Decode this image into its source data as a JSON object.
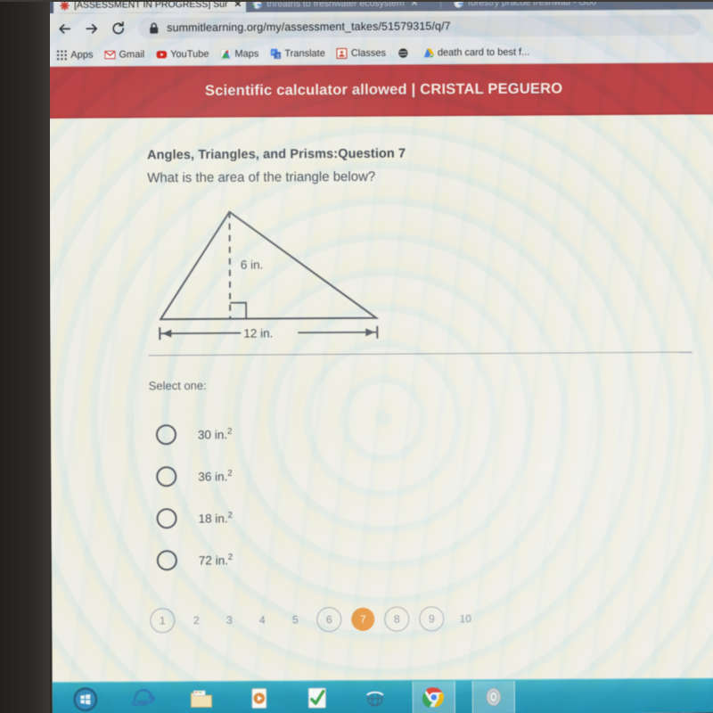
{
  "browser": {
    "tabs": [
      {
        "title": "[ASSESSMENT IN PROGRESS] Sur",
        "favicon": "summit-asterisk-icon",
        "active": true,
        "close": "✕"
      },
      {
        "title": "threaths to freshwater ecosystem",
        "favicon": "google-icon",
        "active": false,
        "close": "✕"
      },
      {
        "title": "forestry pracue freshwati - Goo",
        "favicon": "google-icon",
        "active": false,
        "close": ""
      }
    ],
    "nav": {
      "back": "←",
      "forward": "→",
      "reload": "⟳"
    },
    "omnibox": {
      "lock": "lock-icon",
      "url": "summitlearning.org/my/assessment_takes/51579315/q/7"
    },
    "bookmarks": [
      {
        "label": "Apps",
        "icon": "apps-grid-icon"
      },
      {
        "label": "Gmail",
        "icon": "gmail-icon"
      },
      {
        "label": "YouTube",
        "icon": "youtube-icon"
      },
      {
        "label": "Maps",
        "icon": "maps-icon"
      },
      {
        "label": "Translate",
        "icon": "translate-icon"
      },
      {
        "label": "Classes",
        "icon": "classroom-icon"
      },
      {
        "label": "",
        "icon": "dark-globe-icon"
      },
      {
        "label": "death card to best f...",
        "icon": "google-drive-icon"
      }
    ]
  },
  "banner": {
    "text": "Scientific calculator allowed | CRISTAL PEGUERO",
    "color": "#c74144"
  },
  "assessment": {
    "title": "Angles, Triangles, and Prisms:Question 7",
    "prompt": "What is the area of the triangle below?",
    "select_label": "Select one:",
    "figure": {
      "height_label": "6 in.",
      "base_label": "12 in.",
      "right_angle_marker": true
    },
    "options": [
      {
        "value": "30",
        "unit": "in.",
        "exponent": "2",
        "selected": false
      },
      {
        "value": "36",
        "unit": "in.",
        "exponent": "2",
        "selected": false
      },
      {
        "value": "18",
        "unit": "in.",
        "exponent": "2",
        "selected": false
      },
      {
        "value": "72",
        "unit": "in.",
        "exponent": "2",
        "selected": false
      }
    ],
    "pagination": {
      "pages": [
        {
          "label": "1",
          "ring": true,
          "active": false
        },
        {
          "label": "2",
          "ring": false,
          "active": false
        },
        {
          "label": "3",
          "ring": false,
          "active": false
        },
        {
          "label": "4",
          "ring": false,
          "active": false
        },
        {
          "label": "5",
          "ring": false,
          "active": false
        },
        {
          "label": "6",
          "ring": true,
          "active": false
        },
        {
          "label": "7",
          "ring": false,
          "active": true
        },
        {
          "label": "8",
          "ring": true,
          "active": false
        },
        {
          "label": "9",
          "ring": true,
          "active": false
        },
        {
          "label": "10",
          "ring": false,
          "active": false
        }
      ],
      "active_color": "#ef9a3c"
    }
  },
  "taskbar": {
    "items": [
      {
        "icon": "windows-start-orb-icon",
        "open": false
      },
      {
        "icon": "internet-explorer-icon",
        "open": false
      },
      {
        "icon": "windows-explorer-folder-icon",
        "open": false
      },
      {
        "icon": "media-player-icon",
        "open": false
      },
      {
        "icon": "green-check-app-icon",
        "open": false
      },
      {
        "icon": "network-globe-icon",
        "open": false
      },
      {
        "icon": "google-chrome-icon",
        "open": true
      },
      {
        "icon": "speaker-icon",
        "open": true
      }
    ]
  }
}
